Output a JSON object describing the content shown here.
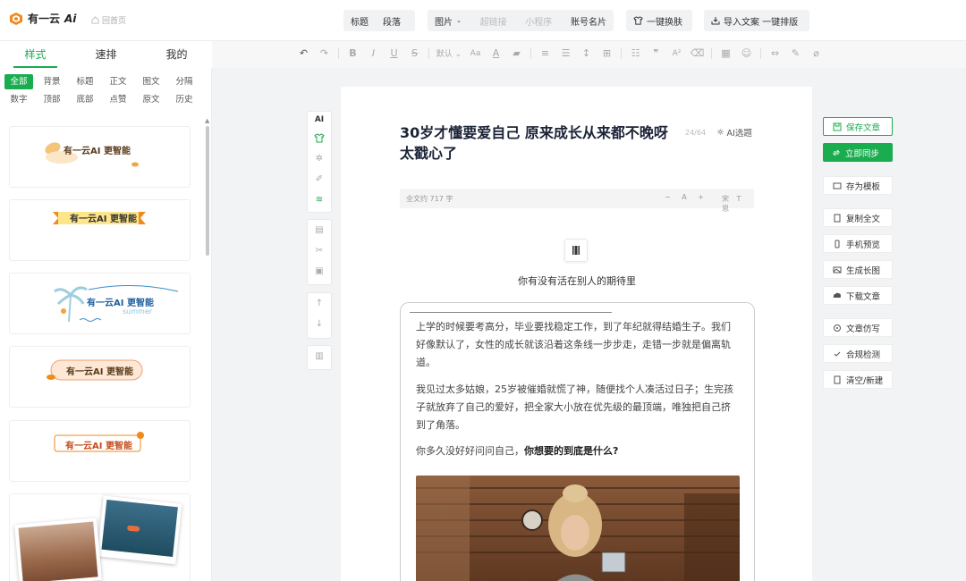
{
  "app": {
    "brand": "有一云",
    "brand_suffix": "Ai",
    "home_link": "回首页"
  },
  "top_groups": {
    "group1": [
      "标题",
      "段落"
    ],
    "group2": {
      "image_menu": "图片",
      "disabled": [
        "超链接",
        "小程序"
      ],
      "name_card": "账号名片"
    },
    "skin_button": "一键换肤",
    "import_button": "导入文案 一键排版"
  },
  "left_tabs": [
    "样式",
    "速排",
    "我的"
  ],
  "categories": [
    "全部",
    "背景",
    "标题",
    "正文",
    "图文",
    "分隔",
    "数字",
    "顶部",
    "底部",
    "点赞",
    "原文",
    "历史"
  ],
  "templates": {
    "banner_text": "有一云AI 更智能",
    "summer_word": "summer"
  },
  "format_tools": {
    "font_default": "默认"
  },
  "editor": {
    "title": "30岁才懂要爱自己 原来成长从来都不晚呀 太戳心了",
    "title_count": "24/64",
    "ai_topic": "AI选题",
    "word_count": "全文约 717 字",
    "zoom": "− A +",
    "font_ctl": "宋 T 思",
    "subtitle": "你有没有活在别人的期待里",
    "paragraphs": [
      "上学的时候要考高分，毕业要找稳定工作，到了年纪就得结婚生子。我们好像默认了，女性的成长就该沿着这条线一步步走，走错一步就是偏离轨道。",
      "我见过太多姑娘，25岁被催婚就慌了神，随便找个人凑活过日子；生完孩子就放弃了自己的爱好，把全家大小放在优先级的最顶端，唯独把自己挤到了角落。"
    ],
    "question_prefix": "你多久没好好问问自己，",
    "question_bold": "你想要的到底是什么?"
  },
  "side_tool_ai": "AI",
  "right_actions": {
    "save": "保存文章",
    "sync": "立即同步",
    "save_template": "存为模板",
    "copy_all": "复制全文",
    "mobile_preview": "手机预览",
    "long_image": "生成长图",
    "download": "下载文章",
    "imitate": "文章仿写",
    "compliance": "合规检测",
    "clear_new": "清空/新建"
  },
  "colors": {
    "accent": "#1aad4f",
    "brand_orange": "#f08a1c",
    "title_navy": "#1b2336"
  }
}
